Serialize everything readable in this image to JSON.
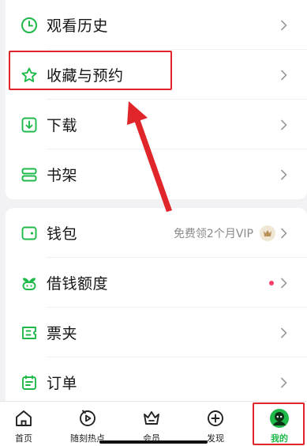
{
  "menu_top": {
    "items": [
      {
        "label": "观看历史",
        "icon": "clock-icon"
      },
      {
        "label": "收藏与预约",
        "icon": "star-icon"
      },
      {
        "label": "下载",
        "icon": "download-icon"
      },
      {
        "label": "书架",
        "icon": "bookshelf-icon"
      }
    ]
  },
  "menu_bottom": {
    "items": [
      {
        "label": "钱包",
        "icon": "wallet-icon",
        "extra_text": "免费领2个月VIP"
      },
      {
        "label": "借钱额度",
        "icon": "sprout-icon"
      },
      {
        "label": "票夹",
        "icon": "ticket-icon"
      },
      {
        "label": "订单",
        "icon": "order-icon"
      }
    ]
  },
  "tabbar": {
    "tabs": [
      {
        "label": "首页",
        "icon": "home-icon"
      },
      {
        "label": "随刻热点",
        "icon": "play-icon"
      },
      {
        "label": "会员",
        "icon": "crown-icon"
      },
      {
        "label": "发现",
        "icon": "plus-icon"
      },
      {
        "label": "我的",
        "icon": "profile-icon",
        "active": true
      }
    ]
  },
  "colors": {
    "accent_green": "#1fb94a",
    "annotation_red": "#e0262b",
    "badge_dot": "#ff3d6a"
  }
}
